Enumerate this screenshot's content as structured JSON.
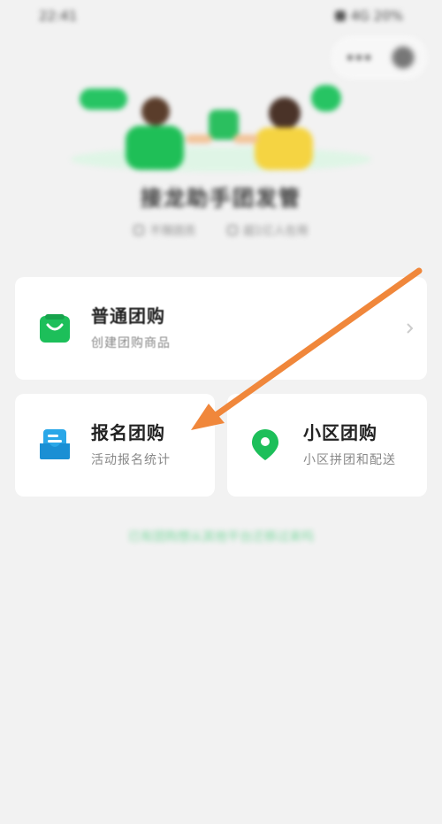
{
  "status_bar": {
    "time": "22:41",
    "right_text": "4G 20%"
  },
  "hero": {
    "title": "接龙助手团发管",
    "subtitle_left": "不限团员",
    "subtitle_right": "超1亿人在用"
  },
  "cards": [
    {
      "title": "普通团购",
      "desc": "创建团购商品",
      "icon": "shopping-bag-icon"
    },
    {
      "title": "报名团购",
      "desc": "活动报名统计",
      "icon": "inbox-icon"
    },
    {
      "title": "小区团购",
      "desc": "小区拼团和配送",
      "icon": "location-pin-icon"
    }
  ],
  "footer": {
    "link_text": "已有团购想从其他平台迁移过来吗"
  },
  "colors": {
    "green": "#1db954",
    "blue": "#2aa7e8",
    "arrow": "#f0873b"
  }
}
